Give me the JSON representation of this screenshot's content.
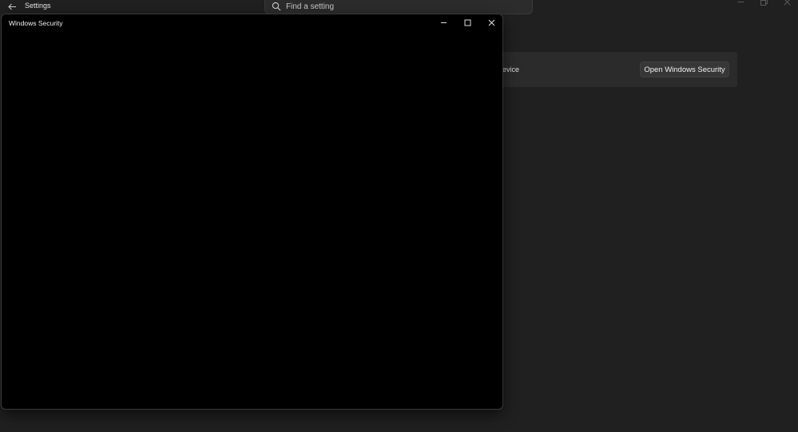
{
  "settings": {
    "title": "Settings",
    "search_placeholder": "Find a setting",
    "card_text": "this device.",
    "open_button": "Open Windows Security"
  },
  "security_window": {
    "title": "Windows Security"
  },
  "icons": {
    "back": "back-arrow-icon",
    "search": "search-icon",
    "minimize": "minimize-icon",
    "maximize": "maximize-icon",
    "restore": "restore-icon",
    "close": "close-icon"
  },
  "colors": {
    "settings_background": "#202020",
    "card_background": "#2b2b2b",
    "security_background": "#000000",
    "text": "#e6e6e6"
  }
}
